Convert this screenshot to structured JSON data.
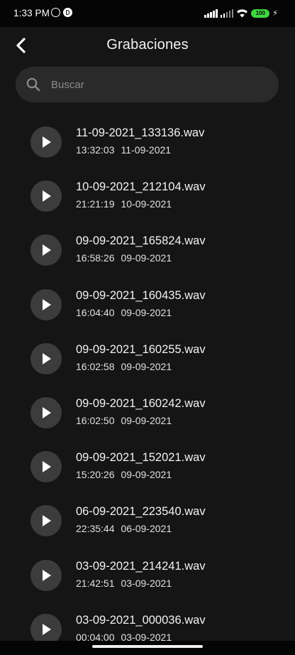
{
  "status_bar": {
    "time": "1:33 PM",
    "battery": "100"
  },
  "header": {
    "title": "Grabaciones"
  },
  "search": {
    "placeholder": "Buscar",
    "value": ""
  },
  "recordings": [
    {
      "name": "11-09-2021_133136.wav",
      "time": "13:32:03",
      "date": "11-09-2021"
    },
    {
      "name": "10-09-2021_212104.wav",
      "time": "21:21:19",
      "date": "10-09-2021"
    },
    {
      "name": "09-09-2021_165824.wav",
      "time": "16:58:26",
      "date": "09-09-2021"
    },
    {
      "name": "09-09-2021_160435.wav",
      "time": "16:04:40",
      "date": "09-09-2021"
    },
    {
      "name": "09-09-2021_160255.wav",
      "time": "16:02:58",
      "date": "09-09-2021"
    },
    {
      "name": "09-09-2021_160242.wav",
      "time": "16:02:50",
      "date": "09-09-2021"
    },
    {
      "name": "09-09-2021_152021.wav",
      "time": "15:20:26",
      "date": "09-09-2021"
    },
    {
      "name": "06-09-2021_223540.wav",
      "time": "22:35:44",
      "date": "06-09-2021"
    },
    {
      "name": "03-09-2021_214241.wav",
      "time": "21:42:51",
      "date": "03-09-2021"
    },
    {
      "name": "03-09-2021_000036.wav",
      "time": "00:04:00",
      "date": "03-09-2021"
    }
  ],
  "icons": {
    "back": "chevron-left-icon",
    "search": "search-icon",
    "play": "play-icon"
  },
  "colors": {
    "background": "#151515",
    "search_bg": "#2a2a2a",
    "play_bg": "#3c3c3c",
    "battery": "#3fd63f"
  }
}
